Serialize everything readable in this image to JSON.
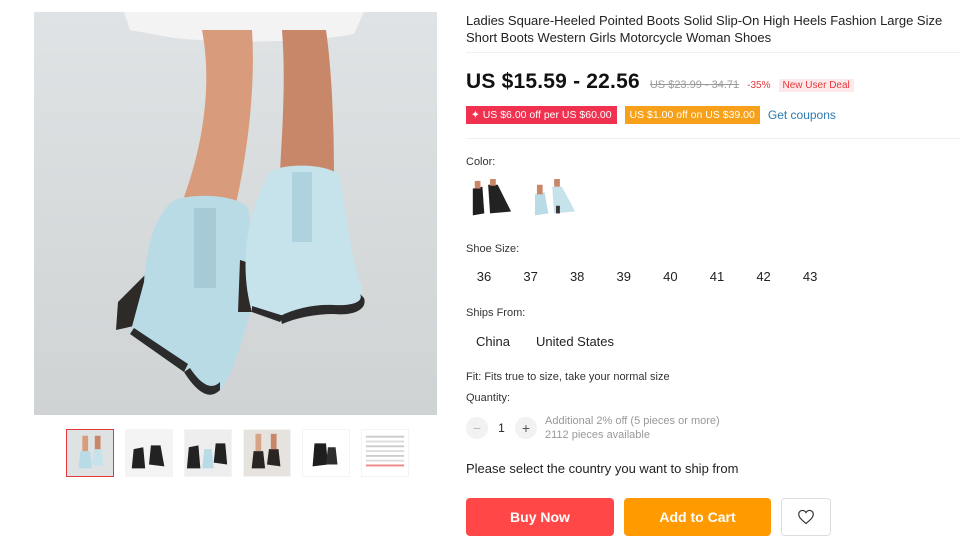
{
  "product": {
    "title": "Ladies Square-Heeled Pointed Boots Solid Slip-On High Heels Fashion Large Size Short Boots Western Girls Motorcycle Woman Shoes",
    "price": "US $15.59 - 22.56",
    "original_price": "US $23.99 - 34.71",
    "discount": "-35%",
    "deal_badge": "New User Deal"
  },
  "coupons": {
    "store_coupon": "US $6.00 off per US $60.00",
    "select_coupon": "US $1.00 off on US $39.00",
    "get_coupons": "Get coupons"
  },
  "color": {
    "label": "Color:",
    "options": [
      {
        "name": "black",
        "color": "#222222"
      },
      {
        "name": "light blue",
        "color": "#b9dbe6"
      }
    ]
  },
  "size": {
    "label": "Shoe Size:",
    "options": [
      "36",
      "37",
      "38",
      "39",
      "40",
      "41",
      "42",
      "43"
    ]
  },
  "ships_from": {
    "label": "Ships From:",
    "options": [
      "China",
      "United States"
    ]
  },
  "fit": "Fit: Fits true to size, take your normal size",
  "quantity": {
    "label": "Quantity:",
    "value": "1",
    "minus": "−",
    "plus": "+",
    "discount_note": "Additional 2% off (5 pieces or more)",
    "available": "2112 pieces available"
  },
  "ship_message": "Please select the country you want to ship from",
  "actions": {
    "buy_now": "Buy Now",
    "add_to_cart": "Add to Cart",
    "wishlist_icon": "heart-icon"
  },
  "gallery": {
    "thumbnail_count": 6,
    "active_index": 0
  },
  "colors": {
    "price_red": "#e4393c",
    "coupon_red": "#f0314f",
    "coupon_orange": "#f7a11a",
    "link_blue": "#2e7ab3",
    "buy_button": "#ff4747",
    "cart_button": "#ff9a00"
  }
}
